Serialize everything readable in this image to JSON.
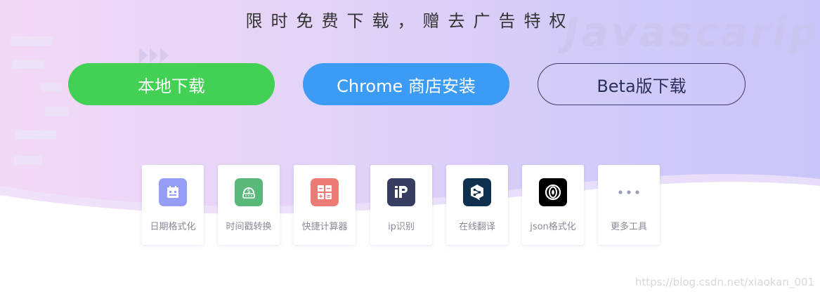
{
  "hero": {
    "headline": "限时免费下载，赠去广告特权",
    "background_word": "Javascarip"
  },
  "buttons": {
    "local_download": "本地下载",
    "chrome_store": "Chrome 商店安装",
    "beta_download": "Beta版下载"
  },
  "tools": [
    {
      "label": "日期格式化",
      "icon": "calendar-icon",
      "color": "#959df7"
    },
    {
      "label": "时间戳转换",
      "icon": "timestamp-icon",
      "color": "#5bb77a"
    },
    {
      "label": "快捷计算器",
      "icon": "calculator-icon",
      "color": "#ec7b75"
    },
    {
      "label": "ip识别",
      "icon": "ip-icon",
      "color": "#363d60"
    },
    {
      "label": "在线翻译",
      "icon": "translate-icon",
      "color": "#0f2f4f"
    },
    {
      "label": "json格式化",
      "icon": "json-icon",
      "color": "#000000"
    },
    {
      "label": "更多工具",
      "icon": "more-dots-icon",
      "color": "#9a9cb8"
    }
  ],
  "watermark": "https://blog.csdn.net/xiaokan_001",
  "colors": {
    "green": "#42d055",
    "blue": "#3b9bf5",
    "beta_border": "#3b3a78"
  }
}
